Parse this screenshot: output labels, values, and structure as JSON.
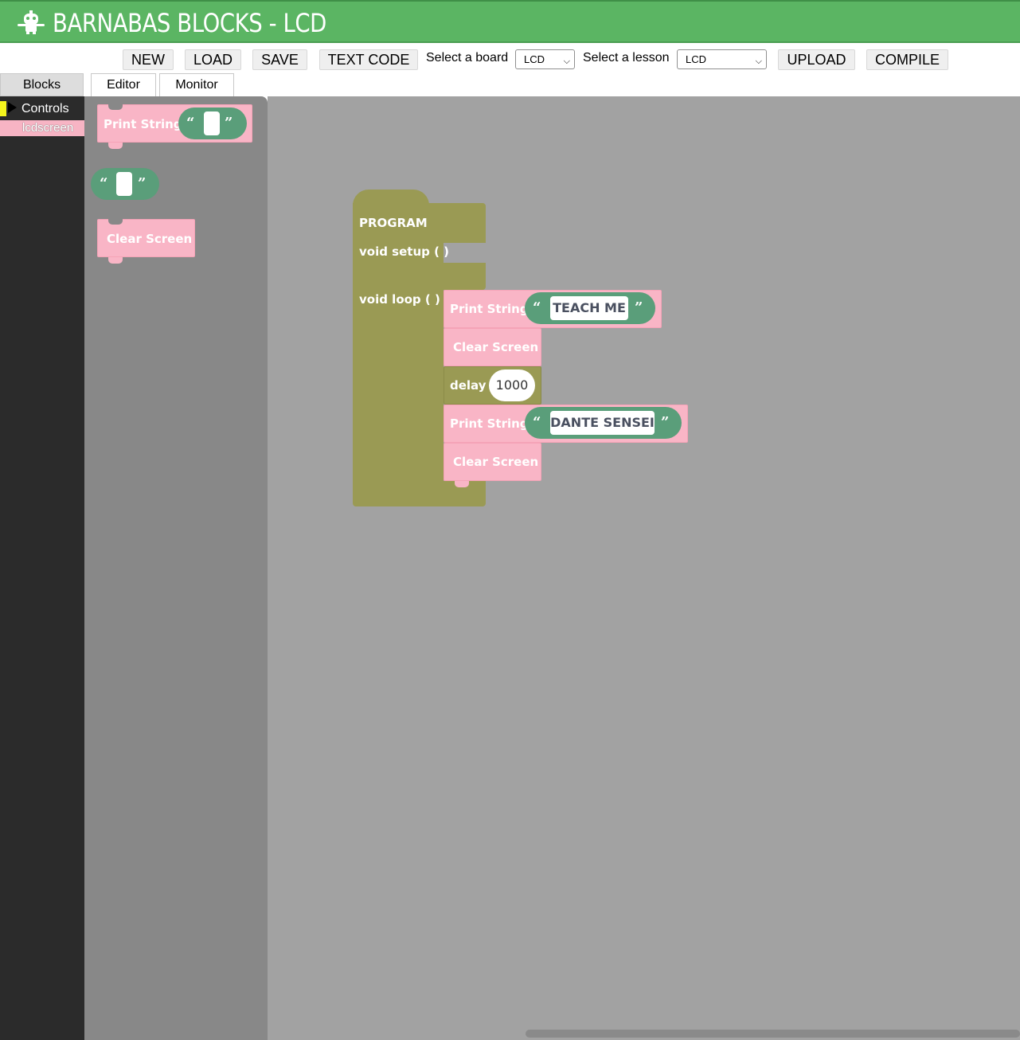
{
  "header": {
    "title": "BARNABAS BLOCKS - LCD",
    "logo_icon": "robot-icon"
  },
  "toolbar": {
    "new_label": "NEW",
    "load_label": "LOAD",
    "save_label": "SAVE",
    "text_code_label": "TEXT CODE",
    "board_label": "Select a board",
    "board_value": "LCD",
    "lesson_label": "Select a lesson",
    "lesson_value": "LCD",
    "upload_label": "UPLOAD",
    "compile_label": "COMPILE"
  },
  "tabs": {
    "blocks": "Blocks",
    "editor": "Editor",
    "monitor": "Monitor"
  },
  "sidebar": {
    "categories": [
      {
        "label": "Controls",
        "color": "#f5f51d"
      },
      {
        "label": "lcdscreen",
        "color": "#f7b4c4"
      }
    ]
  },
  "flyout": {
    "print_string": "Print String",
    "clear_screen": "Clear Screen"
  },
  "program": {
    "title": "PROGRAM",
    "setup": "void setup ( )",
    "loop": "void loop ( )",
    "statements": [
      {
        "type": "print",
        "label": "Print String",
        "value": "TEACH ME"
      },
      {
        "type": "clear",
        "label": "Clear Screen"
      },
      {
        "type": "delay",
        "label": "delay",
        "value": "1000"
      },
      {
        "type": "print",
        "label": "Print String",
        "value": "DANTE SENSEI"
      },
      {
        "type": "clear",
        "label": "Clear Screen"
      }
    ]
  },
  "colors": {
    "header": "#5bb563",
    "lcd_block": "#f9b5c6",
    "text_block": "#5a9e7a",
    "program_block": "#9a9a54"
  }
}
